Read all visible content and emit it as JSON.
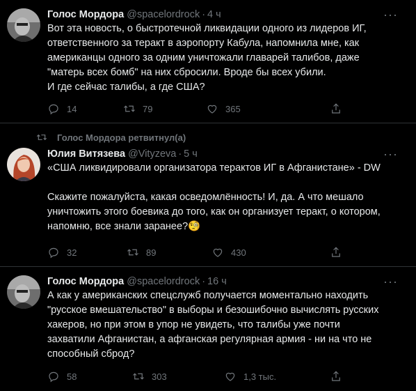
{
  "tweets": [
    {
      "name": "Голос Мордора",
      "handle": "@spacelordrock",
      "time": "4 ч",
      "text": "Вот эта новость, о быстротечной ликвидации одного из лидеров ИГ,\nответственного за теракт в аэропорту Кабула, напомнила мне, как\nамериканцы одного за одним уничтожали главарей талибов, даже\n\"матерь всех бомб\" на них сбросили. Вроде бы всех убили.\nИ где сейчас талибы, а где США?",
      "replies": "14",
      "retweets": "79",
      "likes": "365"
    },
    {
      "retweeted_by": "Голос Мордора ретвитнул(а)",
      "name": "Юлия Витязева",
      "handle": "@Vityzeva",
      "time": "5 ч",
      "text": "«США ликвидировали организатора терактов ИГ в Афганистане» - DW\n\nСкажите пожалуйста, какая осведомлённость! И, да. А что мешало\nуничтожить этого боевика до того, как он организует теракт, о котором,\nнапомню, все знали заранее?",
      "emoji": "🧐",
      "replies": "32",
      "retweets": "89",
      "likes": "430"
    },
    {
      "name": "Голос Мордора",
      "handle": "@spacelordrock",
      "time": "16 ч",
      "text": "А как у американских спецслужб получается моментально находить\n\"русское вмешательство\" в выборы и безошибочно вычислять русских\nхакеров, но при этом в упор не увидеть, что талибы уже почти\nзахватили Афганистан, а афганская регулярная армия - ни на что не\nспособный сброд?",
      "replies": "58",
      "retweets": "303",
      "likes": "1,3 тыс."
    }
  ],
  "icons": {
    "reply": "reply-icon",
    "retweet": "retweet-icon",
    "like": "heart-icon",
    "share": "share-icon",
    "more": "more-icon"
  },
  "colors": {
    "background": "#000000",
    "text": "#e7e9ea",
    "secondary": "#71767b",
    "divider": "#2f3336"
  }
}
